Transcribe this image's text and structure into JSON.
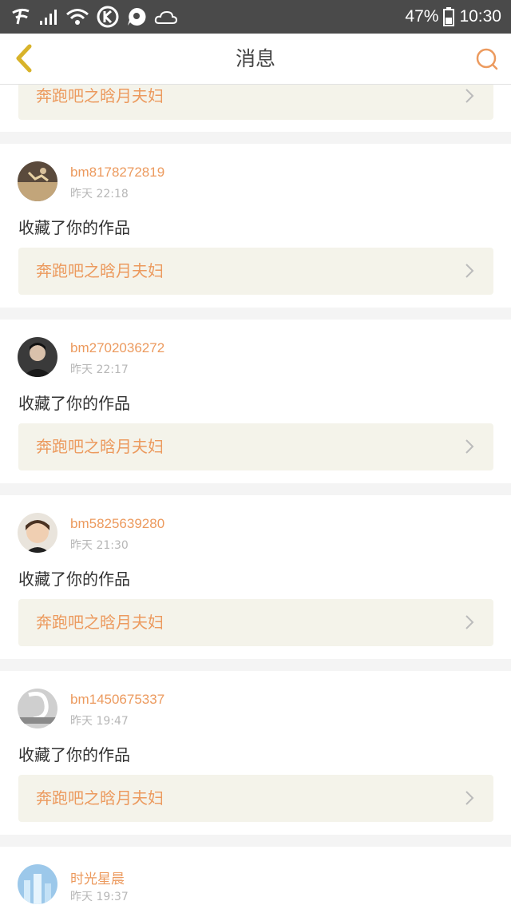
{
  "status_bar": {
    "battery": "47%",
    "time": "10:30",
    "icons": [
      "carrier-icon",
      "signal-icon",
      "wifi-icon",
      "k-app-icon",
      "p-app-icon",
      "weather-icon",
      "battery-icon"
    ]
  },
  "nav": {
    "title": "消息",
    "back_icon": "chevron-left-icon",
    "search_icon": "search-icon"
  },
  "colors": {
    "accent": "#ec9a5e",
    "back_icon": "#d8b32a",
    "card_bg": "#f4f3ea"
  },
  "feed": {
    "top_partial_work": "奔跑吧之晗月夫妇",
    "items": [
      {
        "username": "bm8178272819",
        "time": "昨天 22:18",
        "action": "收藏了你的作品",
        "work": "奔跑吧之晗月夫妇"
      },
      {
        "username": "bm2702036272",
        "time": "昨天 22:17",
        "action": "收藏了你的作品",
        "work": "奔跑吧之晗月夫妇"
      },
      {
        "username": "bm5825639280",
        "time": "昨天 21:30",
        "action": "收藏了你的作品",
        "work": "奔跑吧之晗月夫妇"
      },
      {
        "username": "bm1450675337",
        "time": "昨天 19:47",
        "action": "收藏了你的作品",
        "work": "奔跑吧之晗月夫妇"
      },
      {
        "username": "时光星晨",
        "time": "昨天 19:37"
      }
    ]
  }
}
